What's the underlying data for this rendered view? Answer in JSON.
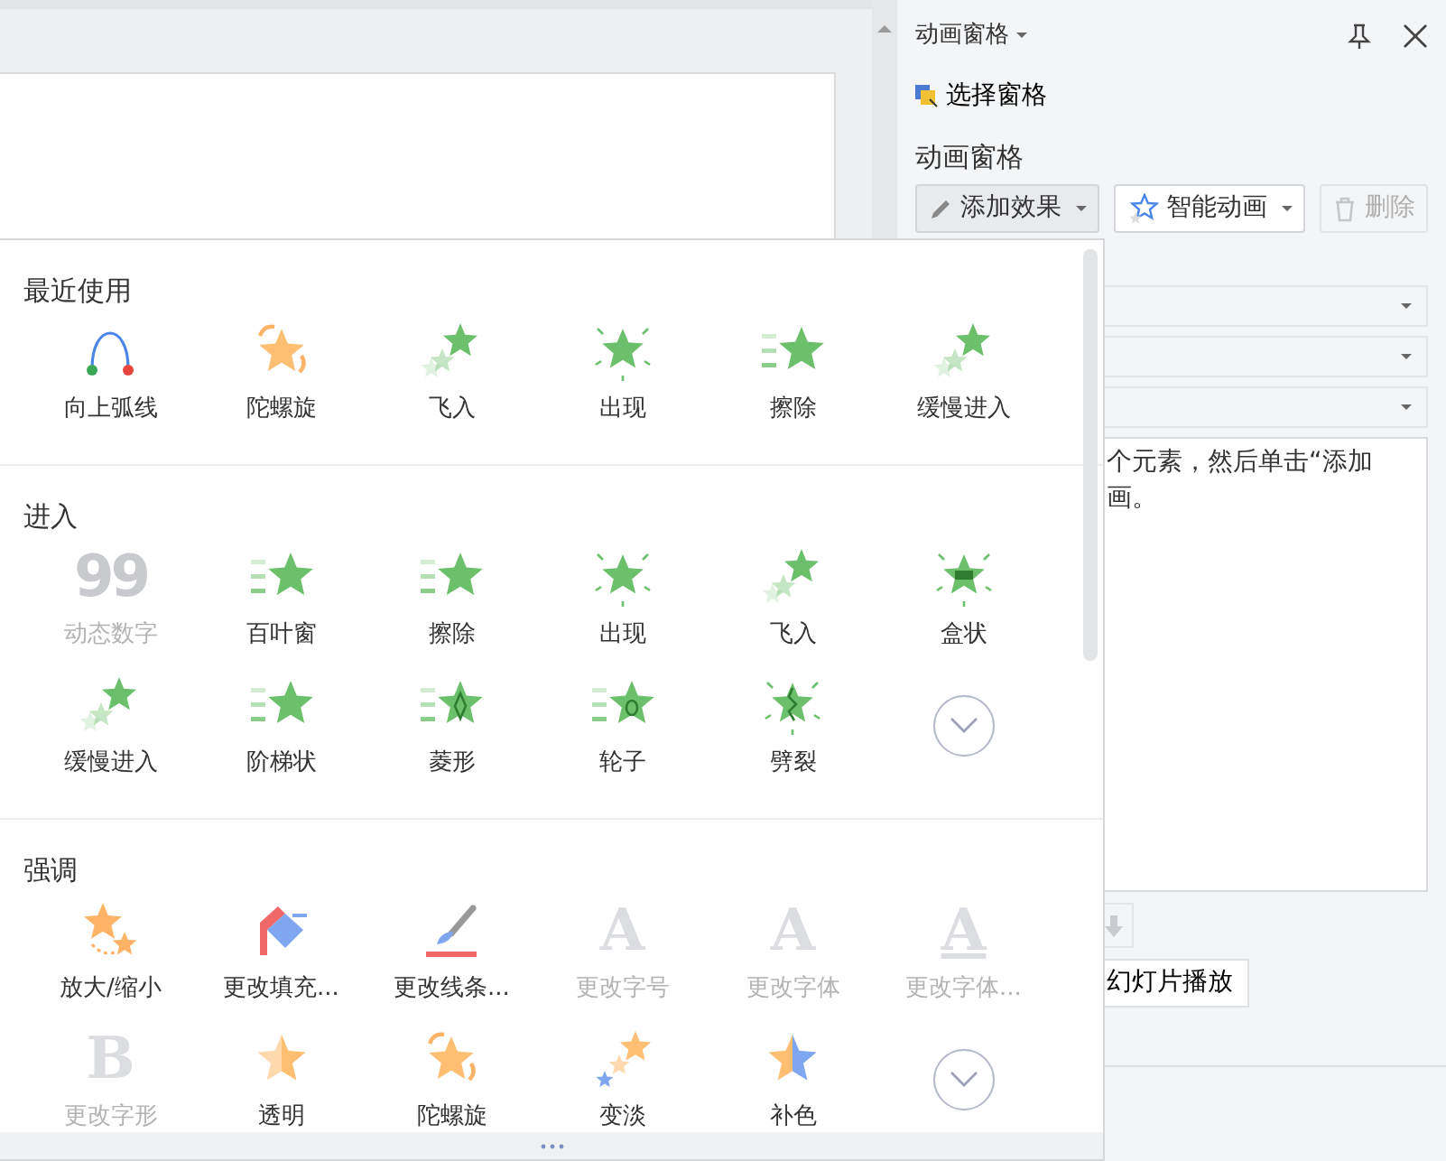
{
  "task_pane": {
    "title": "动画窗格",
    "selection_pane": "选择窗格",
    "heading": "动画窗格",
    "toolbar": [
      {
        "label": "添加效果",
        "dropdown": true,
        "disabled": false
      },
      {
        "label": "智能动画",
        "dropdown": true,
        "disabled": false
      },
      {
        "label": "删除",
        "dropdown": false,
        "disabled": true
      }
    ],
    "hint_lines": [
      "个元素，然后单击“添加",
      "画。"
    ],
    "play_button": "幻灯片播放"
  },
  "effects_gallery": {
    "sections": [
      {
        "title": "最近使用",
        "items": [
          {
            "kind": "arc",
            "label": "向上弧线",
            "disabled": false
          },
          {
            "kind": "spiral",
            "label": "陀螺旋",
            "disabled": false
          },
          {
            "kind": "fly",
            "label": "飞入",
            "disabled": false
          },
          {
            "kind": "appear",
            "label": "出现",
            "disabled": false
          },
          {
            "kind": "wipe",
            "label": "擦除",
            "disabled": false
          },
          {
            "kind": "fly",
            "label": "缓慢进入",
            "disabled": false
          }
        ]
      },
      {
        "title": "进入",
        "items": [
          {
            "kind": "glyph",
            "glyph": "99",
            "label": "动态数字",
            "disabled": true
          },
          {
            "kind": "wipe",
            "label": "百叶窗",
            "disabled": false
          },
          {
            "kind": "wipe",
            "label": "擦除",
            "disabled": false
          },
          {
            "kind": "appear",
            "label": "出现",
            "disabled": false
          },
          {
            "kind": "fly",
            "label": "飞入",
            "disabled": false
          },
          {
            "kind": "box",
            "label": "盒状",
            "disabled": false
          },
          {
            "kind": "fly",
            "label": "缓慢进入",
            "disabled": false
          },
          {
            "kind": "wipe",
            "label": "阶梯状",
            "disabled": false
          },
          {
            "kind": "diamond",
            "label": "菱形",
            "disabled": false
          },
          {
            "kind": "wheel",
            "label": "轮子",
            "disabled": false
          },
          {
            "kind": "split",
            "label": "劈裂",
            "disabled": false
          },
          {
            "kind": "more"
          }
        ]
      },
      {
        "title": "强调",
        "items": [
          {
            "kind": "zoom",
            "label": "放大/缩小",
            "disabled": false
          },
          {
            "kind": "fill",
            "label": "更改填充...",
            "disabled": false
          },
          {
            "kind": "line",
            "label": "更改线条...",
            "disabled": false
          },
          {
            "kind": "glyph",
            "glyph": "A",
            "label": "更改字号",
            "disabled": true
          },
          {
            "kind": "glyph",
            "glyph": "A",
            "label": "更改字体",
            "disabled": true
          },
          {
            "kind": "glyph",
            "glyph": "A",
            "underline": true,
            "label": "更改字体...",
            "disabled": true
          },
          {
            "kind": "glyph",
            "glyph": "B",
            "label": "更改字形",
            "disabled": true
          },
          {
            "kind": "transparent",
            "label": "透明",
            "disabled": false
          },
          {
            "kind": "spiral",
            "label": "陀螺旋",
            "disabled": false
          },
          {
            "kind": "fade",
            "label": "变淡",
            "disabled": false
          },
          {
            "kind": "complement",
            "label": "补色",
            "disabled": false
          },
          {
            "kind": "more"
          }
        ]
      }
    ]
  }
}
